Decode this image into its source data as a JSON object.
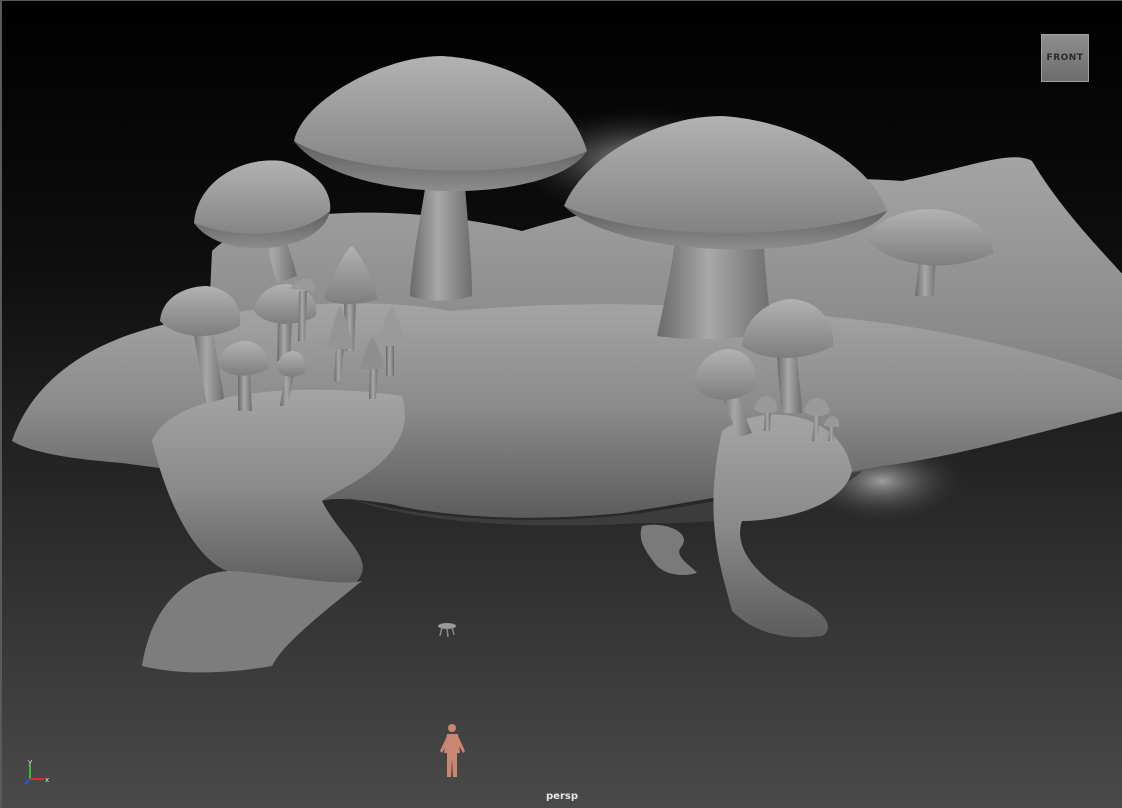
{
  "viewport": {
    "camera_name": "persp",
    "view_cube_label": "FRONT",
    "axis_labels": {
      "x": "x",
      "y": "y",
      "z": "z"
    }
  },
  "scene_objects": [
    "mushroom-island",
    "giant-mushroom-cap",
    "mushroom-cluster",
    "human-reference-figure",
    "small-stool-prop"
  ],
  "colors": {
    "background_top": "#000000",
    "background_bottom": "#4a4a4a",
    "model_gray": "#8a8a8a",
    "figure_skin": "#c98772",
    "axis_x": "#d23030",
    "axis_y": "#30c030",
    "axis_z": "#3050e0"
  }
}
